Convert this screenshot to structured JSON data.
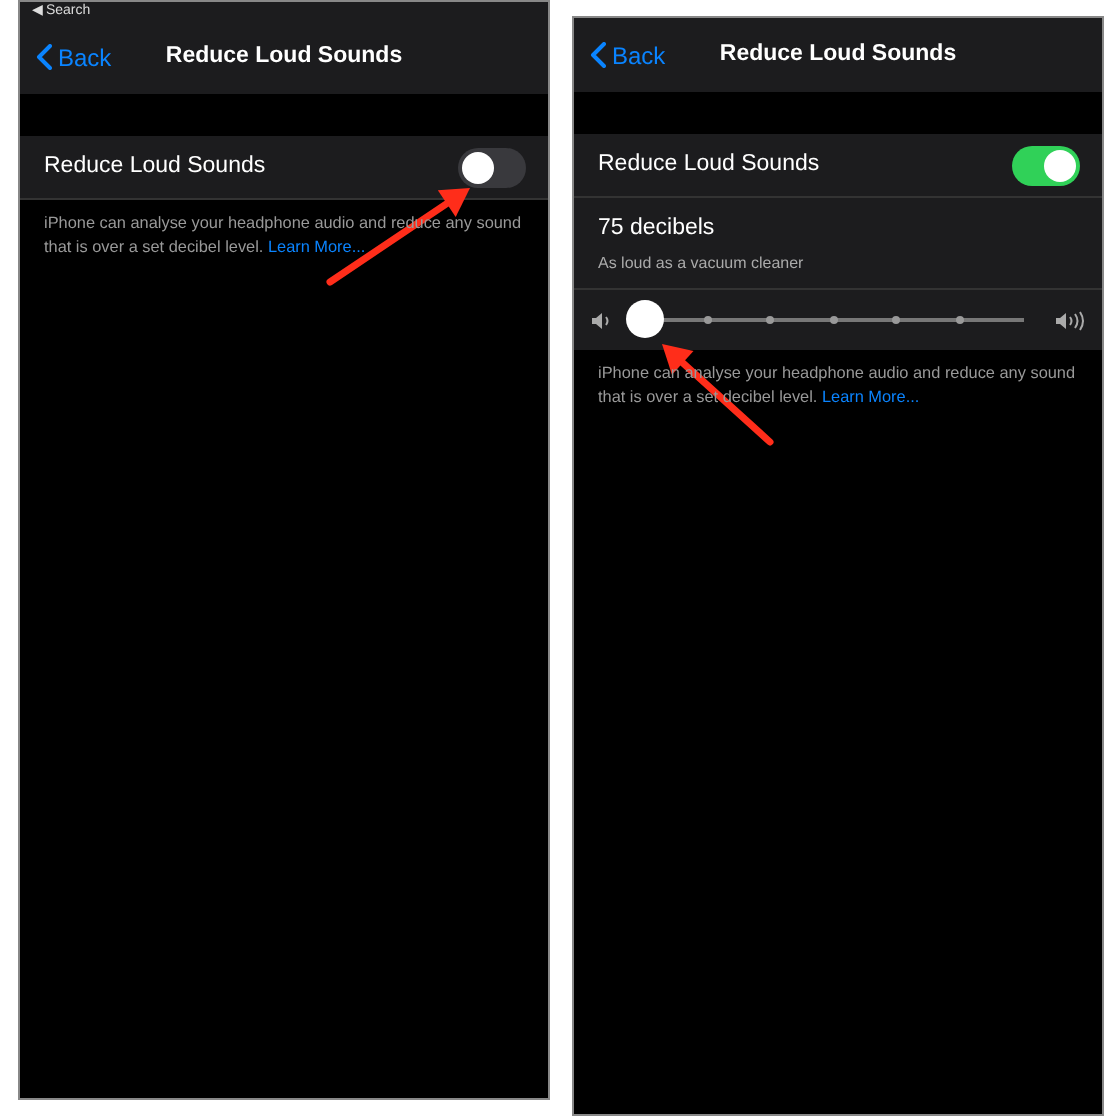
{
  "screens": [
    {
      "status_back": "◀ Search",
      "nav": {
        "back": "Back",
        "title": "Reduce Loud Sounds"
      },
      "toggle": {
        "label": "Reduce Loud Sounds",
        "on": false
      },
      "footer": {
        "text": "iPhone can analyse your headphone audio and reduce any sound that is over a set decibel level.",
        "link": "Learn More..."
      },
      "arrow": true
    },
    {
      "nav": {
        "back": "Back",
        "title": "Reduce Loud Sounds"
      },
      "toggle": {
        "label": "Reduce Loud Sounds",
        "on": true
      },
      "level_info": {
        "value": "75 decibels",
        "description": "As loud as a vacuum cleaner"
      },
      "slider": {
        "level": 0
      },
      "footer": {
        "text": "iPhone can analyse your headphone audio and reduce any sound that is over a set decibel level.",
        "link": "Learn More..."
      },
      "arrow": true
    }
  ]
}
